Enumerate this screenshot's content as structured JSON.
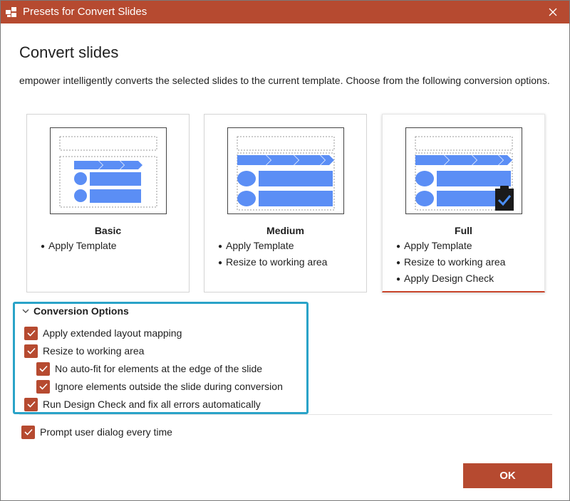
{
  "window": {
    "title": "Presets for Convert Slides",
    "accent_color": "#b64a30",
    "highlight_color": "#2aa3c8",
    "icons": [
      "app-icon",
      "close-icon"
    ]
  },
  "main": {
    "heading": "Convert slides",
    "description": "empower intelligently converts the selected slides to the current template. Choose from the following conversion options."
  },
  "presets": [
    {
      "name": "Basic",
      "selected": false,
      "bullets": [
        "Apply Template"
      ]
    },
    {
      "name": "Medium",
      "selected": false,
      "bullets": [
        "Apply Template",
        "Resize to working area"
      ]
    },
    {
      "name": "Full",
      "selected": true,
      "bullets": [
        "Apply Template",
        "Resize to working area",
        "Apply Design Check"
      ]
    }
  ],
  "conversion_options": {
    "header": "Conversion Options",
    "expanded": true,
    "items": [
      {
        "label": "Apply extended layout mapping",
        "checked": true,
        "indent": 0
      },
      {
        "label": "Resize to working area",
        "checked": true,
        "indent": 0
      },
      {
        "label": "No auto-fit for elements at the edge of the slide",
        "checked": true,
        "indent": 1
      },
      {
        "label": "Ignore elements outside the slide during conversion",
        "checked": true,
        "indent": 1
      },
      {
        "label": "Run Design Check and fix all errors automatically",
        "checked": true,
        "indent": 0
      }
    ]
  },
  "prompt_option": {
    "label": "Prompt user dialog every time",
    "checked": true
  },
  "footer": {
    "ok_label": "OK"
  }
}
